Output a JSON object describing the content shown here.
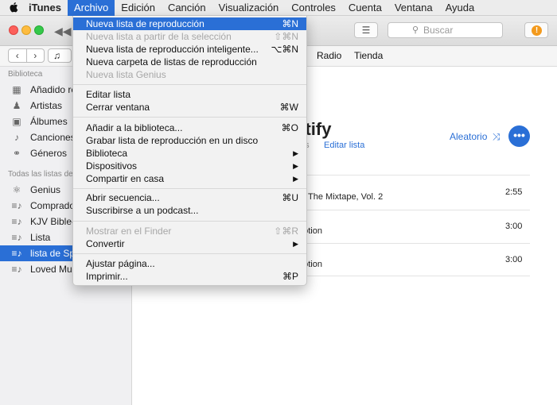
{
  "menubar": {
    "items": [
      "iTunes",
      "Archivo",
      "Edición",
      "Canción",
      "Visualización",
      "Controles",
      "Cuenta",
      "Ventana",
      "Ayuda"
    ]
  },
  "toolbar": {
    "search_placeholder": "Buscar"
  },
  "navbar": {
    "tabs": [
      "Radio",
      "Tienda"
    ]
  },
  "sidebar": {
    "library_title": "Biblioteca",
    "library_items": [
      {
        "label": "Añadido re",
        "icon": "grid-icon"
      },
      {
        "label": "Artistas",
        "icon": "microphone-icon"
      },
      {
        "label": "Álbumes",
        "icon": "album-icon"
      },
      {
        "label": "Canciones",
        "icon": "music-note-icon"
      },
      {
        "label": "Géneros",
        "icon": "genres-icon"
      }
    ],
    "playlists_title": "Todas las listas de",
    "playlists": [
      {
        "label": "Genius",
        "icon": "genius-icon"
      },
      {
        "label": "Comprado",
        "icon": "playlist-icon"
      },
      {
        "label": "KJV Bible-",
        "icon": "playlist-icon"
      },
      {
        "label": "Lista",
        "icon": "playlist-icon"
      },
      {
        "label": "lista de Sp",
        "icon": "playlist-icon",
        "selected": true
      },
      {
        "label": "Loved Mus",
        "icon": "playlist-icon"
      }
    ]
  },
  "playlist": {
    "title": "otify",
    "subtitle": "tos",
    "edit_label": "Editar lista",
    "shuffle_label": "Aleatorio",
    "more_label": "•••",
    "tracks": [
      {
        "title": "e: The Mixtape, Vol. 2",
        "time": "2:55"
      },
      {
        "title": "notion",
        "time": "3:00"
      },
      {
        "title": "notion",
        "time": "3:00"
      }
    ]
  },
  "archivo_menu": {
    "groups": [
      [
        {
          "label": "Nueva lista de reproducción",
          "shortcut": "⌘N",
          "highlighted": true
        },
        {
          "label": "Nueva lista a partir de la selección",
          "shortcut": "⇧⌘N",
          "disabled": true
        },
        {
          "label": "Nueva lista de reproducción inteligente...",
          "shortcut": "⌥⌘N"
        },
        {
          "label": "Nueva carpeta de listas de reproducción",
          "shortcut": ""
        },
        {
          "label": "Nueva lista Genius",
          "shortcut": "",
          "disabled": true
        }
      ],
      [
        {
          "label": "Editar lista",
          "shortcut": ""
        },
        {
          "label": "Cerrar ventana",
          "shortcut": "⌘W"
        }
      ],
      [
        {
          "label": "Añadir a la biblioteca...",
          "shortcut": "⌘O"
        },
        {
          "label": "Grabar lista de reproducción en un disco",
          "shortcut": ""
        },
        {
          "label": "Biblioteca",
          "shortcut": "",
          "submenu": true
        },
        {
          "label": "Dispositivos",
          "shortcut": "",
          "submenu": true
        },
        {
          "label": "Compartir en casa",
          "shortcut": "",
          "submenu": true
        }
      ],
      [
        {
          "label": "Abrir secuencia...",
          "shortcut": "⌘U"
        },
        {
          "label": "Suscribirse a un podcast...",
          "shortcut": ""
        }
      ],
      [
        {
          "label": "Mostrar en el Finder",
          "shortcut": "⇧⌘R",
          "disabled": true
        },
        {
          "label": "Convertir",
          "shortcut": "",
          "submenu": true
        }
      ],
      [
        {
          "label": "Ajustar página...",
          "shortcut": ""
        },
        {
          "label": "Imprimir...",
          "shortcut": "⌘P"
        }
      ]
    ]
  },
  "colors": {
    "accent": "#2a6fd6",
    "sidebar_bg": "#f0f0f2",
    "menu_bg": "#f2f2f2"
  }
}
